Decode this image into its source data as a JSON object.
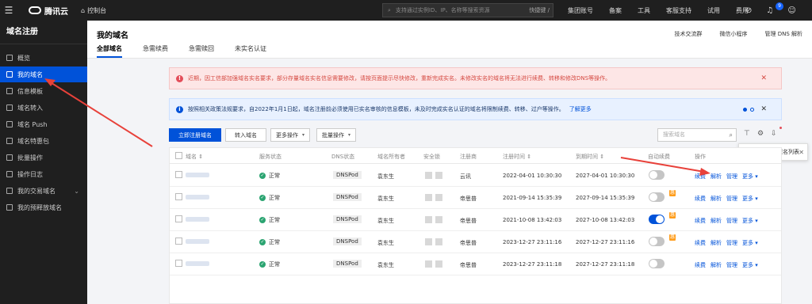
{
  "topbar": {
    "brand": "腾讯云",
    "console": "控制台",
    "search_placeholder": "支持通过实例ID、IP、名称等搜索资源",
    "search_shortcut": "快捷键 /",
    "nav": [
      "集团账号",
      "备案",
      "工具",
      "客服支持",
      "试用",
      "费用"
    ],
    "notification_count": "9"
  },
  "sidebar": {
    "title": "域名注册",
    "items": [
      {
        "label": "概览"
      },
      {
        "label": "我的域名"
      },
      {
        "label": "信息模板"
      },
      {
        "label": "域名转入"
      },
      {
        "label": "域名 Push"
      },
      {
        "label": "域名特惠包"
      },
      {
        "label": "批量操作"
      },
      {
        "label": "操作日志"
      },
      {
        "label": "我的交易域名"
      },
      {
        "label": "我的预释放域名"
      }
    ]
  },
  "header": {
    "title": "我的域名",
    "links": [
      "技术交流群",
      "微信小程序",
      "管理 DNS 解析"
    ],
    "tabs": [
      "全部域名",
      "急需续费",
      "急需赎回",
      "未实名认证"
    ]
  },
  "alerts": {
    "error_text": "近期，因工信部加强域名实名要求，部分存量域名实名信息需要修改，请按页面提示尽快修改，重新完成实名。未修改实名的域名将无法进行续费、转移和修改DNS等操作。",
    "info_text": "按照相关政策法规要求，自2022年1月1日起，域名注册前必须使用已实名审核的信息模板，未及时完成实名认证的域名将限制续费、转移、过户等操作。",
    "info_link": "了解更多"
  },
  "toolbar": {
    "register": "立即注册域名",
    "transfer": "转入域名",
    "more_ops": "更多操作",
    "batch_ops": "批量操作",
    "search_placeholder": "搜索域名"
  },
  "tooltip": {
    "text": "点击快速导出域名列表"
  },
  "table": {
    "headers": {
      "name": "域名 ⇕",
      "service": "服务状态",
      "dns": "DNS状态",
      "owner": "域名所有者",
      "security": "安全锁",
      "registrar": "注册商",
      "reg_time": "注册时间 ⇕",
      "exp_time": "到期时间 ⇕",
      "auto_renew": "自动续费",
      "ops": "操作"
    },
    "rows": [
      {
        "status": "正常",
        "dns": "DNSPod",
        "owner": "袁东生",
        "registrar": "云讯",
        "reg_time": "2022-04-01 10:30:30",
        "exp_time": "2027-04-01 10:30:30",
        "auto_renew": false,
        "gift": false
      },
      {
        "status": "正常",
        "dns": "DNSPod",
        "owner": "袁东生",
        "registrar": "帝思普",
        "reg_time": "2021-09-14 15:35:39",
        "exp_time": "2027-09-14 15:35:39",
        "auto_renew": false,
        "gift": true
      },
      {
        "status": "正常",
        "dns": "DNSPod",
        "owner": "袁东生",
        "registrar": "帝思普",
        "reg_time": "2021-10-08 13:42:03",
        "exp_time": "2027-10-08 13:42:03",
        "auto_renew": true,
        "gift": true
      },
      {
        "status": "正常",
        "dns": "DNSPod",
        "owner": "袁东生",
        "registrar": "帝思普",
        "reg_time": "2023-12-27 23:11:16",
        "exp_time": "2027-12-27 23:11:16",
        "auto_renew": false,
        "gift": true
      },
      {
        "status": "正常",
        "dns": "DNSPod",
        "owner": "袁东生",
        "registrar": "帝思普",
        "reg_time": "2023-12-27 23:11:18",
        "exp_time": "2027-12-27 23:11:18",
        "auto_renew": false,
        "gift": false
      }
    ],
    "ops": [
      "续费",
      "解析",
      "管理",
      "更多 ▾"
    ]
  }
}
